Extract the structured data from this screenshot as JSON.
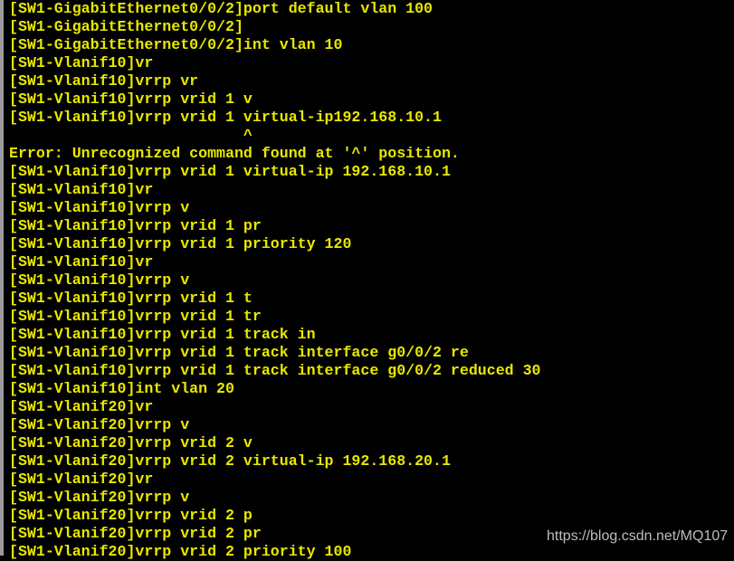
{
  "terminal": {
    "text_color": "#e8e800",
    "background": "#000000",
    "lines": [
      "[SW1-GigabitEthernet0/0/2]port default vlan 100",
      "[SW1-GigabitEthernet0/0/2]",
      "[SW1-GigabitEthernet0/0/2]int vlan 10",
      "[SW1-Vlanif10]vr",
      "[SW1-Vlanif10]vrrp vr",
      "[SW1-Vlanif10]vrrp vrid 1 v",
      "[SW1-Vlanif10]vrrp vrid 1 virtual-ip192.168.10.1",
      "                          ^",
      "Error: Unrecognized command found at '^' position.",
      "[SW1-Vlanif10]vrrp vrid 1 virtual-ip 192.168.10.1",
      "[SW1-Vlanif10]vr",
      "[SW1-Vlanif10]vrrp v",
      "[SW1-Vlanif10]vrrp vrid 1 pr",
      "[SW1-Vlanif10]vrrp vrid 1 priority 120",
      "[SW1-Vlanif10]vr",
      "[SW1-Vlanif10]vrrp v",
      "[SW1-Vlanif10]vrrp vrid 1 t",
      "[SW1-Vlanif10]vrrp vrid 1 tr",
      "[SW1-Vlanif10]vrrp vrid 1 track in",
      "[SW1-Vlanif10]vrrp vrid 1 track interface g0/0/2 re",
      "[SW1-Vlanif10]vrrp vrid 1 track interface g0/0/2 reduced 30",
      "[SW1-Vlanif10]int vlan 20",
      "[SW1-Vlanif20]vr",
      "[SW1-Vlanif20]vrrp v",
      "[SW1-Vlanif20]vrrp vrid 2 v",
      "[SW1-Vlanif20]vrrp vrid 2 virtual-ip 192.168.20.1",
      "[SW1-Vlanif20]vr",
      "[SW1-Vlanif20]vrrp v",
      "[SW1-Vlanif20]vrrp vrid 2 p",
      "[SW1-Vlanif20]vrrp vrid 2 pr",
      "[SW1-Vlanif20]vrrp vrid 2 priority 100"
    ]
  },
  "watermark": "https://blog.csdn.net/MQ107"
}
